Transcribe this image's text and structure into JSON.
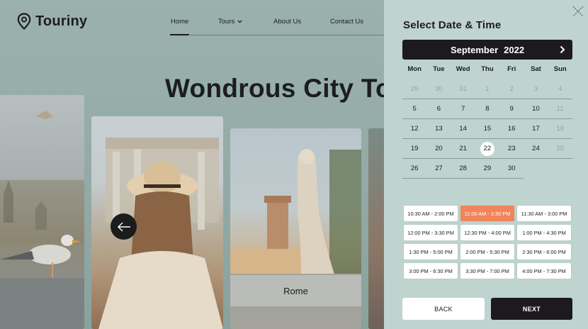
{
  "site": {
    "logo_text": "Touriny",
    "nav": {
      "home": "Home",
      "tours": "Tours",
      "about": "About Us",
      "contact": "Contact Us"
    },
    "hero_title": "Wondrous City To",
    "card_label": "Rome"
  },
  "panel": {
    "title": "Select Date & Time",
    "calendar": {
      "month": "September",
      "year": "2022",
      "weekdays": [
        "Mon",
        "Tue",
        "Wed",
        "Thu",
        "Fri",
        "Sat",
        "Sun"
      ],
      "weeks": [
        [
          "29",
          "30",
          "31",
          "1",
          "2",
          "3",
          "4"
        ],
        [
          "5",
          "6",
          "7",
          "8",
          "9",
          "10",
          "11"
        ],
        [
          "12",
          "13",
          "14",
          "15",
          "16",
          "17",
          "18"
        ],
        [
          "19",
          "20",
          "21",
          "22",
          "23",
          "24",
          "25"
        ],
        [
          "26",
          "27",
          "28",
          "29",
          "30"
        ]
      ],
      "selected_day": "22"
    },
    "time_slots": [
      "10:30 AM - 2:00 PM",
      "11:00 AM - 2:30 PM",
      "11:30 AM - 3:00 PM",
      "12:00 PM - 3:30 PM",
      "12:30 PM - 4:00 PM",
      "1:00 PM - 4:30 PM",
      "1:30 PM - 5:00 PM",
      "2:00 PM - 5:30 PM",
      "2:30 PM - 6:00 PM",
      "3:00 PM - 6:30 PM",
      "3:30 PM - 7:00 PM",
      "4:00 PM - 7:30 PM"
    ],
    "selected_slot": "11:00 AM - 2:30 PM",
    "buttons": {
      "back": "BACK",
      "next": "NEXT"
    }
  },
  "colors": {
    "accent": "#f1845a",
    "dark": "#1c1a1f",
    "panel_bg": "#bfd3cf"
  }
}
